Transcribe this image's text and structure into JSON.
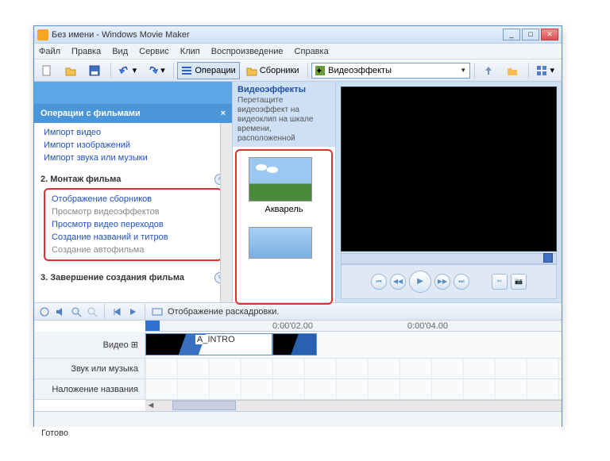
{
  "window": {
    "title": "Без имени - Windows Movie Maker"
  },
  "menu": {
    "file": "Файл",
    "edit": "Правка",
    "view": "Вид",
    "service": "Сервис",
    "clip": "Клип",
    "playback": "Воспроизведение",
    "help": "Справка"
  },
  "toolbar": {
    "operations": "Операции",
    "collections": "Сборники",
    "dropdown_value": "Видеоэффекты"
  },
  "tasks": {
    "header": "Операции с фильмами",
    "sec1_items": {
      "video": "Импорт видео",
      "images": "Импорт изображений",
      "audio": "Импорт звука или музыки"
    },
    "sec2": {
      "title": "2. Монтаж фильма",
      "show_collections": "Отображение сборников",
      "view_effects": "Просмотр видеоэффектов",
      "view_transitions": "Просмотр видео переходов",
      "create_titles": "Создание названий и титров",
      "create_automovie": "Создание автофильма"
    },
    "sec3": {
      "title": "3. Завершение создания фильма"
    }
  },
  "effects": {
    "title": "Видеоэффекты",
    "desc": "Перетащите видеоэффект на видеоклип на шкале времени, расположенной",
    "item1": "Акварель"
  },
  "timeline": {
    "mode_label": "Отображение раскадровки.",
    "ruler": {
      "t1": "0:00'02.00",
      "t2": "0:00'04.00"
    },
    "tracks": {
      "video": "Видео",
      "audio": "Звук или музыка",
      "titles": "Наложение названия"
    },
    "clip1": "A_INTRO"
  },
  "status": {
    "ready": "Готово"
  }
}
